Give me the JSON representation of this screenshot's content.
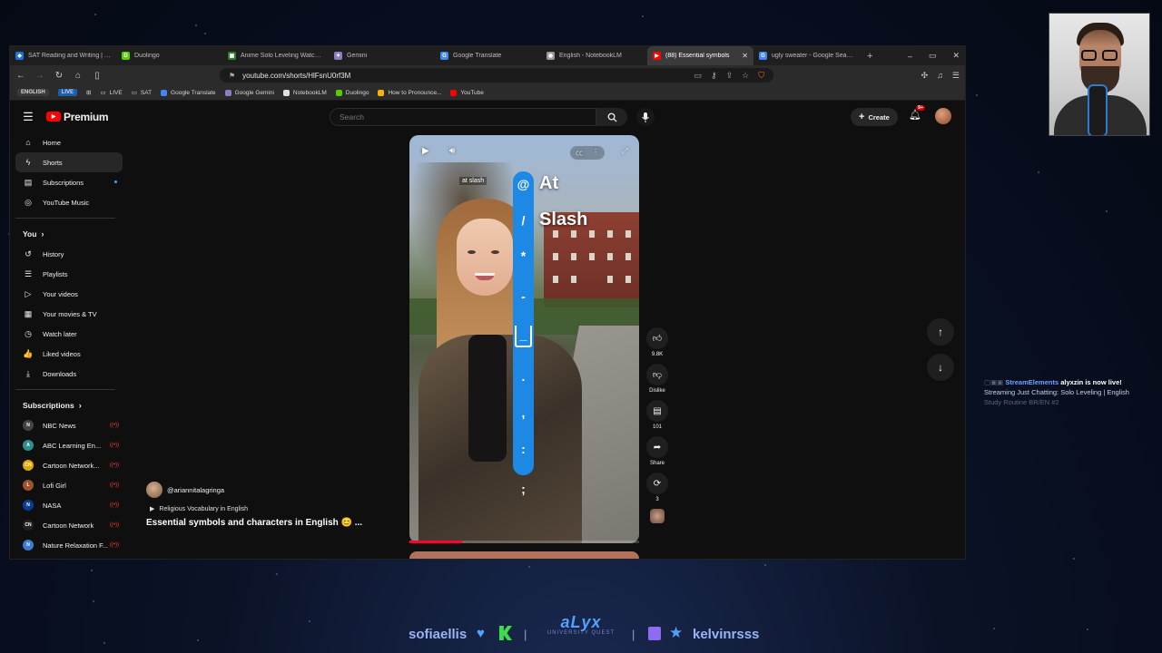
{
  "browser": {
    "tabs": [
      {
        "label": "SAT Reading and Writing | Test",
        "color": "#1a73e8",
        "glyph": "◆"
      },
      {
        "label": "Duolingo",
        "color": "#58cc02",
        "glyph": "D"
      },
      {
        "label": "Anime Solo Leveling Watch On",
        "color": "#2e7d32",
        "glyph": "▣"
      },
      {
        "label": "Gemini",
        "color": "#8e7cc3",
        "glyph": "✦"
      },
      {
        "label": "Google Translate",
        "color": "#4285f4",
        "glyph": "G"
      },
      {
        "label": "English - NotebookLM",
        "color": "#999999",
        "glyph": "◉"
      },
      {
        "label": "(88) Essential symbols",
        "color": "#ff0000",
        "glyph": "▶",
        "active": true
      },
      {
        "label": "ugly sweater - Google Search",
        "color": "#4285f4",
        "glyph": "G"
      }
    ],
    "new_tab": "+",
    "window_controls": [
      "–",
      "▭",
      "✕"
    ],
    "url": "youtube.com/shorts/HlFsnU0rf3M",
    "bookmarks": [
      {
        "label": "ENGLISH",
        "type": "chip",
        "color": "#3a3a3a"
      },
      {
        "label": "LIVE",
        "type": "chip",
        "color": "#1a5fb4"
      },
      {
        "label": "",
        "type": "apps"
      },
      {
        "label": "LIVE",
        "type": "folder"
      },
      {
        "label": "SAT",
        "type": "folder"
      },
      {
        "label": "Google Translate",
        "type": "link",
        "color": "#4285f4"
      },
      {
        "label": "Google Gemini",
        "type": "link",
        "color": "#8e7cc3"
      },
      {
        "label": "NotebookLM",
        "type": "link",
        "color": "#e0e0e0"
      },
      {
        "label": "Duolingo",
        "type": "link",
        "color": "#58cc02"
      },
      {
        "label": "How to Pronounce...",
        "type": "link",
        "color": "#f4b400"
      },
      {
        "label": "YouTube",
        "type": "link",
        "color": "#ff0000"
      }
    ]
  },
  "youtube": {
    "logo_text": "Premium",
    "search_placeholder": "Search",
    "create_label": "Create",
    "notif_badge": "9+",
    "sidebar_top": [
      {
        "label": "Home",
        "icon": "⌂"
      },
      {
        "label": "Shorts",
        "icon": "ϟ",
        "active": true
      },
      {
        "label": "Subscriptions",
        "icon": "▤",
        "dot": true
      },
      {
        "label": "YouTube Music",
        "icon": "◎"
      }
    ],
    "you_header": "You",
    "sidebar_you": [
      {
        "label": "History",
        "icon": "↺"
      },
      {
        "label": "Playlists",
        "icon": "☰"
      },
      {
        "label": "Your videos",
        "icon": "▷"
      },
      {
        "label": "Your movies & TV",
        "icon": "▦"
      },
      {
        "label": "Watch later",
        "icon": "◷"
      },
      {
        "label": "Liked videos",
        "icon": "👍"
      },
      {
        "label": "Downloads",
        "icon": "⤓"
      }
    ],
    "subs_header": "Subscriptions",
    "subscriptions": [
      {
        "label": "NBC News",
        "color": "#444",
        "glyph": "N"
      },
      {
        "label": "ABC Learning En...",
        "color": "#2f8f8f",
        "glyph": "A"
      },
      {
        "label": "Cartoon Network...",
        "color": "#e0a800",
        "glyph": "CN"
      },
      {
        "label": "Lofi Girl",
        "color": "#a0522d",
        "glyph": "L"
      },
      {
        "label": "NASA",
        "color": "#0b3d91",
        "glyph": "N"
      },
      {
        "label": "Cartoon Network",
        "color": "#222",
        "glyph": "CN"
      },
      {
        "label": "Nature Relaxation F...",
        "color": "#3a7bd5",
        "glyph": "N"
      }
    ],
    "short": {
      "caption": "at slash",
      "symbols": [
        {
          "sym": "@",
          "word": "At"
        },
        {
          "sym": "/",
          "word": "Slash"
        },
        {
          "sym": "*",
          "word": ""
        },
        {
          "sym": "-",
          "word": ""
        },
        {
          "sym": "_",
          "word": ""
        },
        {
          "sym": ".",
          "word": ""
        },
        {
          "sym": ",",
          "word": ""
        },
        {
          "sym": ":",
          "word": ""
        },
        {
          "sym": ";",
          "word": ""
        }
      ],
      "progress": 0.23,
      "channel": "@ariannitalagringa",
      "playlist": "Religious Vocabulary in English",
      "title": "Essential symbols and characters in English 😊 ..."
    },
    "actions": {
      "likes": "9.8K",
      "dislike": "Dislike",
      "comments": "101",
      "share": "Share",
      "remix": "3"
    }
  },
  "overlay": {
    "se_name": "StreamElements",
    "se_user": "alyxzin",
    "se_msg": "is now live!",
    "se_line2": "Streaming Just Chatting: Solo Leveling | English",
    "se_line3": "Study Routine BR/EN #2",
    "footer_left": "sofiaellis",
    "footer_right": "kelvinrsss",
    "brand_main": "aLyx",
    "brand_sub": "UNIVERSITY QUEST",
    "pipe": "|"
  }
}
